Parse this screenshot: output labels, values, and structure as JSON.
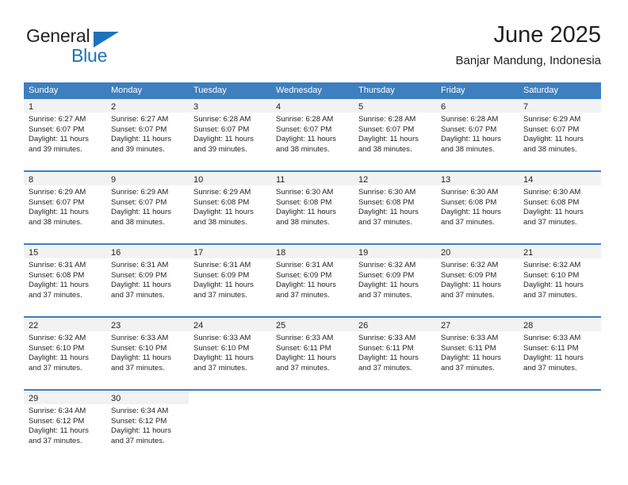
{
  "brand": {
    "word_one": "General",
    "word_two": "Blue",
    "accent_color": "#1c72bb"
  },
  "header": {
    "title": "June 2025",
    "subtitle": "Banjar Mandung, Indonesia"
  },
  "theme": {
    "header_blue": "#3d7fbf",
    "day_band_gray": "#f2f2f2",
    "text_color": "#231f20"
  },
  "weekdays": [
    "Sunday",
    "Monday",
    "Tuesday",
    "Wednesday",
    "Thursday",
    "Friday",
    "Saturday"
  ],
  "weeks": [
    [
      {
        "day": "1",
        "sunrise": "Sunrise: 6:27 AM",
        "sunset": "Sunset: 6:07 PM",
        "daylight_1": "Daylight: 11 hours",
        "daylight_2": "and 39 minutes."
      },
      {
        "day": "2",
        "sunrise": "Sunrise: 6:27 AM",
        "sunset": "Sunset: 6:07 PM",
        "daylight_1": "Daylight: 11 hours",
        "daylight_2": "and 39 minutes."
      },
      {
        "day": "3",
        "sunrise": "Sunrise: 6:28 AM",
        "sunset": "Sunset: 6:07 PM",
        "daylight_1": "Daylight: 11 hours",
        "daylight_2": "and 39 minutes."
      },
      {
        "day": "4",
        "sunrise": "Sunrise: 6:28 AM",
        "sunset": "Sunset: 6:07 PM",
        "daylight_1": "Daylight: 11 hours",
        "daylight_2": "and 38 minutes."
      },
      {
        "day": "5",
        "sunrise": "Sunrise: 6:28 AM",
        "sunset": "Sunset: 6:07 PM",
        "daylight_1": "Daylight: 11 hours",
        "daylight_2": "and 38 minutes."
      },
      {
        "day": "6",
        "sunrise": "Sunrise: 6:28 AM",
        "sunset": "Sunset: 6:07 PM",
        "daylight_1": "Daylight: 11 hours",
        "daylight_2": "and 38 minutes."
      },
      {
        "day": "7",
        "sunrise": "Sunrise: 6:29 AM",
        "sunset": "Sunset: 6:07 PM",
        "daylight_1": "Daylight: 11 hours",
        "daylight_2": "and 38 minutes."
      }
    ],
    [
      {
        "day": "8",
        "sunrise": "Sunrise: 6:29 AM",
        "sunset": "Sunset: 6:07 PM",
        "daylight_1": "Daylight: 11 hours",
        "daylight_2": "and 38 minutes."
      },
      {
        "day": "9",
        "sunrise": "Sunrise: 6:29 AM",
        "sunset": "Sunset: 6:07 PM",
        "daylight_1": "Daylight: 11 hours",
        "daylight_2": "and 38 minutes."
      },
      {
        "day": "10",
        "sunrise": "Sunrise: 6:29 AM",
        "sunset": "Sunset: 6:08 PM",
        "daylight_1": "Daylight: 11 hours",
        "daylight_2": "and 38 minutes."
      },
      {
        "day": "11",
        "sunrise": "Sunrise: 6:30 AM",
        "sunset": "Sunset: 6:08 PM",
        "daylight_1": "Daylight: 11 hours",
        "daylight_2": "and 38 minutes."
      },
      {
        "day": "12",
        "sunrise": "Sunrise: 6:30 AM",
        "sunset": "Sunset: 6:08 PM",
        "daylight_1": "Daylight: 11 hours",
        "daylight_2": "and 37 minutes."
      },
      {
        "day": "13",
        "sunrise": "Sunrise: 6:30 AM",
        "sunset": "Sunset: 6:08 PM",
        "daylight_1": "Daylight: 11 hours",
        "daylight_2": "and 37 minutes."
      },
      {
        "day": "14",
        "sunrise": "Sunrise: 6:30 AM",
        "sunset": "Sunset: 6:08 PM",
        "daylight_1": "Daylight: 11 hours",
        "daylight_2": "and 37 minutes."
      }
    ],
    [
      {
        "day": "15",
        "sunrise": "Sunrise: 6:31 AM",
        "sunset": "Sunset: 6:08 PM",
        "daylight_1": "Daylight: 11 hours",
        "daylight_2": "and 37 minutes."
      },
      {
        "day": "16",
        "sunrise": "Sunrise: 6:31 AM",
        "sunset": "Sunset: 6:09 PM",
        "daylight_1": "Daylight: 11 hours",
        "daylight_2": "and 37 minutes."
      },
      {
        "day": "17",
        "sunrise": "Sunrise: 6:31 AM",
        "sunset": "Sunset: 6:09 PM",
        "daylight_1": "Daylight: 11 hours",
        "daylight_2": "and 37 minutes."
      },
      {
        "day": "18",
        "sunrise": "Sunrise: 6:31 AM",
        "sunset": "Sunset: 6:09 PM",
        "daylight_1": "Daylight: 11 hours",
        "daylight_2": "and 37 minutes."
      },
      {
        "day": "19",
        "sunrise": "Sunrise: 6:32 AM",
        "sunset": "Sunset: 6:09 PM",
        "daylight_1": "Daylight: 11 hours",
        "daylight_2": "and 37 minutes."
      },
      {
        "day": "20",
        "sunrise": "Sunrise: 6:32 AM",
        "sunset": "Sunset: 6:09 PM",
        "daylight_1": "Daylight: 11 hours",
        "daylight_2": "and 37 minutes."
      },
      {
        "day": "21",
        "sunrise": "Sunrise: 6:32 AM",
        "sunset": "Sunset: 6:10 PM",
        "daylight_1": "Daylight: 11 hours",
        "daylight_2": "and 37 minutes."
      }
    ],
    [
      {
        "day": "22",
        "sunrise": "Sunrise: 6:32 AM",
        "sunset": "Sunset: 6:10 PM",
        "daylight_1": "Daylight: 11 hours",
        "daylight_2": "and 37 minutes."
      },
      {
        "day": "23",
        "sunrise": "Sunrise: 6:33 AM",
        "sunset": "Sunset: 6:10 PM",
        "daylight_1": "Daylight: 11 hours",
        "daylight_2": "and 37 minutes."
      },
      {
        "day": "24",
        "sunrise": "Sunrise: 6:33 AM",
        "sunset": "Sunset: 6:10 PM",
        "daylight_1": "Daylight: 11 hours",
        "daylight_2": "and 37 minutes."
      },
      {
        "day": "25",
        "sunrise": "Sunrise: 6:33 AM",
        "sunset": "Sunset: 6:11 PM",
        "daylight_1": "Daylight: 11 hours",
        "daylight_2": "and 37 minutes."
      },
      {
        "day": "26",
        "sunrise": "Sunrise: 6:33 AM",
        "sunset": "Sunset: 6:11 PM",
        "daylight_1": "Daylight: 11 hours",
        "daylight_2": "and 37 minutes."
      },
      {
        "day": "27",
        "sunrise": "Sunrise: 6:33 AM",
        "sunset": "Sunset: 6:11 PM",
        "daylight_1": "Daylight: 11 hours",
        "daylight_2": "and 37 minutes."
      },
      {
        "day": "28",
        "sunrise": "Sunrise: 6:33 AM",
        "sunset": "Sunset: 6:11 PM",
        "daylight_1": "Daylight: 11 hours",
        "daylight_2": "and 37 minutes."
      }
    ],
    [
      {
        "day": "29",
        "sunrise": "Sunrise: 6:34 AM",
        "sunset": "Sunset: 6:12 PM",
        "daylight_1": "Daylight: 11 hours",
        "daylight_2": "and 37 minutes."
      },
      {
        "day": "30",
        "sunrise": "Sunrise: 6:34 AM",
        "sunset": "Sunset: 6:12 PM",
        "daylight_1": "Daylight: 11 hours",
        "daylight_2": "and 37 minutes."
      },
      {
        "day": "",
        "sunrise": "",
        "sunset": "",
        "daylight_1": "",
        "daylight_2": ""
      },
      {
        "day": "",
        "sunrise": "",
        "sunset": "",
        "daylight_1": "",
        "daylight_2": ""
      },
      {
        "day": "",
        "sunrise": "",
        "sunset": "",
        "daylight_1": "",
        "daylight_2": ""
      },
      {
        "day": "",
        "sunrise": "",
        "sunset": "",
        "daylight_1": "",
        "daylight_2": ""
      },
      {
        "day": "",
        "sunrise": "",
        "sunset": "",
        "daylight_1": "",
        "daylight_2": ""
      }
    ]
  ]
}
